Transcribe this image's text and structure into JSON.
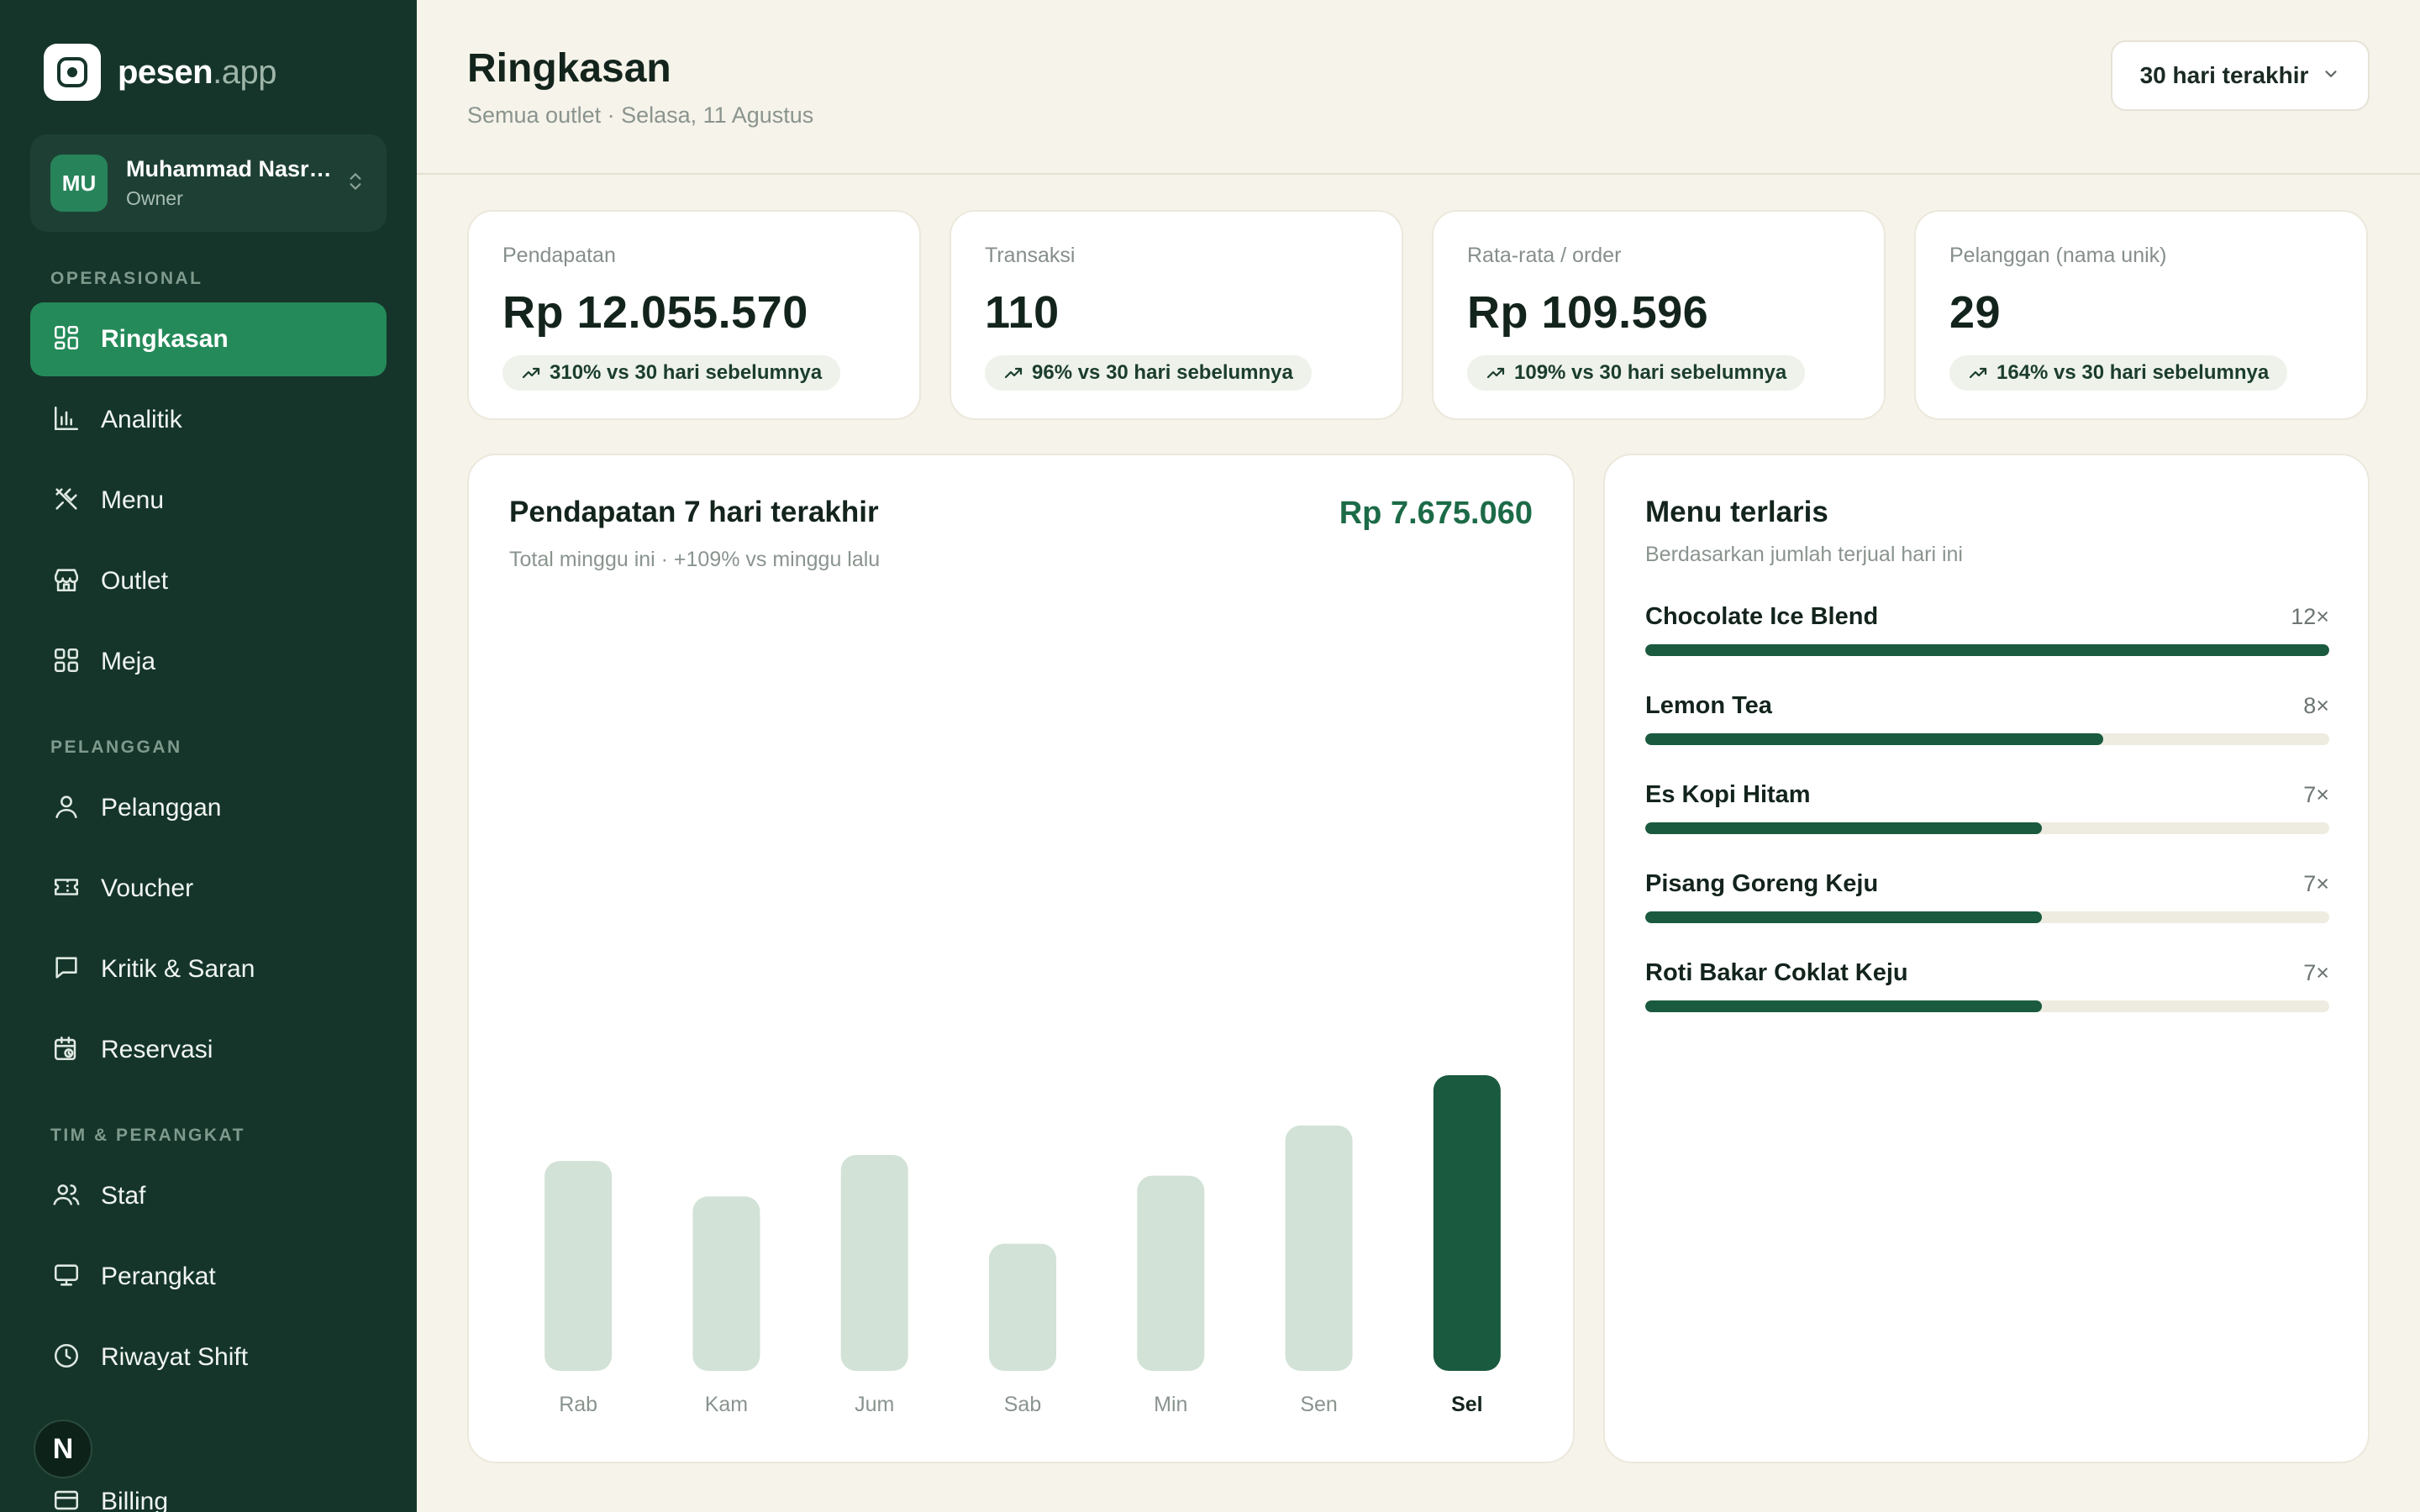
{
  "brand": {
    "name_main": "pesen",
    "name_suffix": ".app"
  },
  "user": {
    "initials": "MU",
    "name": "Muhammad Nasrullah",
    "role": "Owner"
  },
  "sidebar": {
    "sections": [
      {
        "label": "OPERASIONAL",
        "items": [
          {
            "label": "Ringkasan",
            "icon": "dashboard-icon",
            "active": true
          },
          {
            "label": "Analitik",
            "icon": "bar-chart-icon"
          },
          {
            "label": "Menu",
            "icon": "utensils-icon"
          },
          {
            "label": "Outlet",
            "icon": "store-icon"
          },
          {
            "label": "Meja",
            "icon": "grid-icon"
          }
        ]
      },
      {
        "label": "PELANGGAN",
        "items": [
          {
            "label": "Pelanggan",
            "icon": "user-icon"
          },
          {
            "label": "Voucher",
            "icon": "ticket-icon"
          },
          {
            "label": "Kritik & Saran",
            "icon": "message-icon"
          },
          {
            "label": "Reservasi",
            "icon": "calendar-clock-icon"
          }
        ]
      },
      {
        "label": "TIM & PERANGKAT",
        "items": [
          {
            "label": "Staf",
            "icon": "users-icon"
          },
          {
            "label": "Perangkat",
            "icon": "monitor-icon"
          },
          {
            "label": "Riwayat Shift",
            "icon": "clock-icon"
          },
          {
            "label": "Billing",
            "icon": "card-icon"
          }
        ]
      }
    ],
    "badge": "N"
  },
  "header": {
    "title": "Ringkasan",
    "subtitle": "Semua outlet · Selasa, 11 Agustus",
    "range_label": "30 hari terakhir"
  },
  "kpis": [
    {
      "label": "Pendapatan",
      "value": "Rp 12.055.570",
      "delta": "310% vs 30 hari sebelumnya"
    },
    {
      "label": "Transaksi",
      "value": "110",
      "delta": "96% vs 30 hari sebelumnya"
    },
    {
      "label": "Rata-rata / order",
      "value": "Rp 109.596",
      "delta": "109% vs 30 hari sebelumnya"
    },
    {
      "label": "Pelanggan (nama unik)",
      "value": "29",
      "delta": "164% vs 30 hari sebelumnya"
    }
  ],
  "revenue": {
    "title": "Pendapatan 7 hari terakhir",
    "subtitle": "Total minggu ini · +109% vs minggu lalu",
    "total": "Rp 7.675.060"
  },
  "chart_data": {
    "type": "bar",
    "categories": [
      "Rab",
      "Kam",
      "Jum",
      "Sab",
      "Min",
      "Sen",
      "Sel"
    ],
    "values": [
      71,
      59,
      73,
      43,
      66,
      83,
      100
    ],
    "highlight_index": 6,
    "colors": {
      "bar": "#d2e2d6",
      "highlight": "#1a5a3f",
      "label": "#8a948e",
      "label_highlight": "#13241c"
    }
  },
  "top_menu": {
    "title": "Menu terlaris",
    "subtitle": "Berdasarkan jumlah terjual hari ini",
    "items": [
      {
        "name": "Chocolate Ice Blend",
        "count": "12×",
        "fraction": 1.0
      },
      {
        "name": "Lemon Tea",
        "count": "8×",
        "fraction": 0.67
      },
      {
        "name": "Es Kopi Hitam",
        "count": "7×",
        "fraction": 0.58
      },
      {
        "name": "Pisang Goreng Keju",
        "count": "7×",
        "fraction": 0.58
      },
      {
        "name": "Roti Bakar Coklat Keju",
        "count": "7×",
        "fraction": 0.58
      }
    ]
  }
}
